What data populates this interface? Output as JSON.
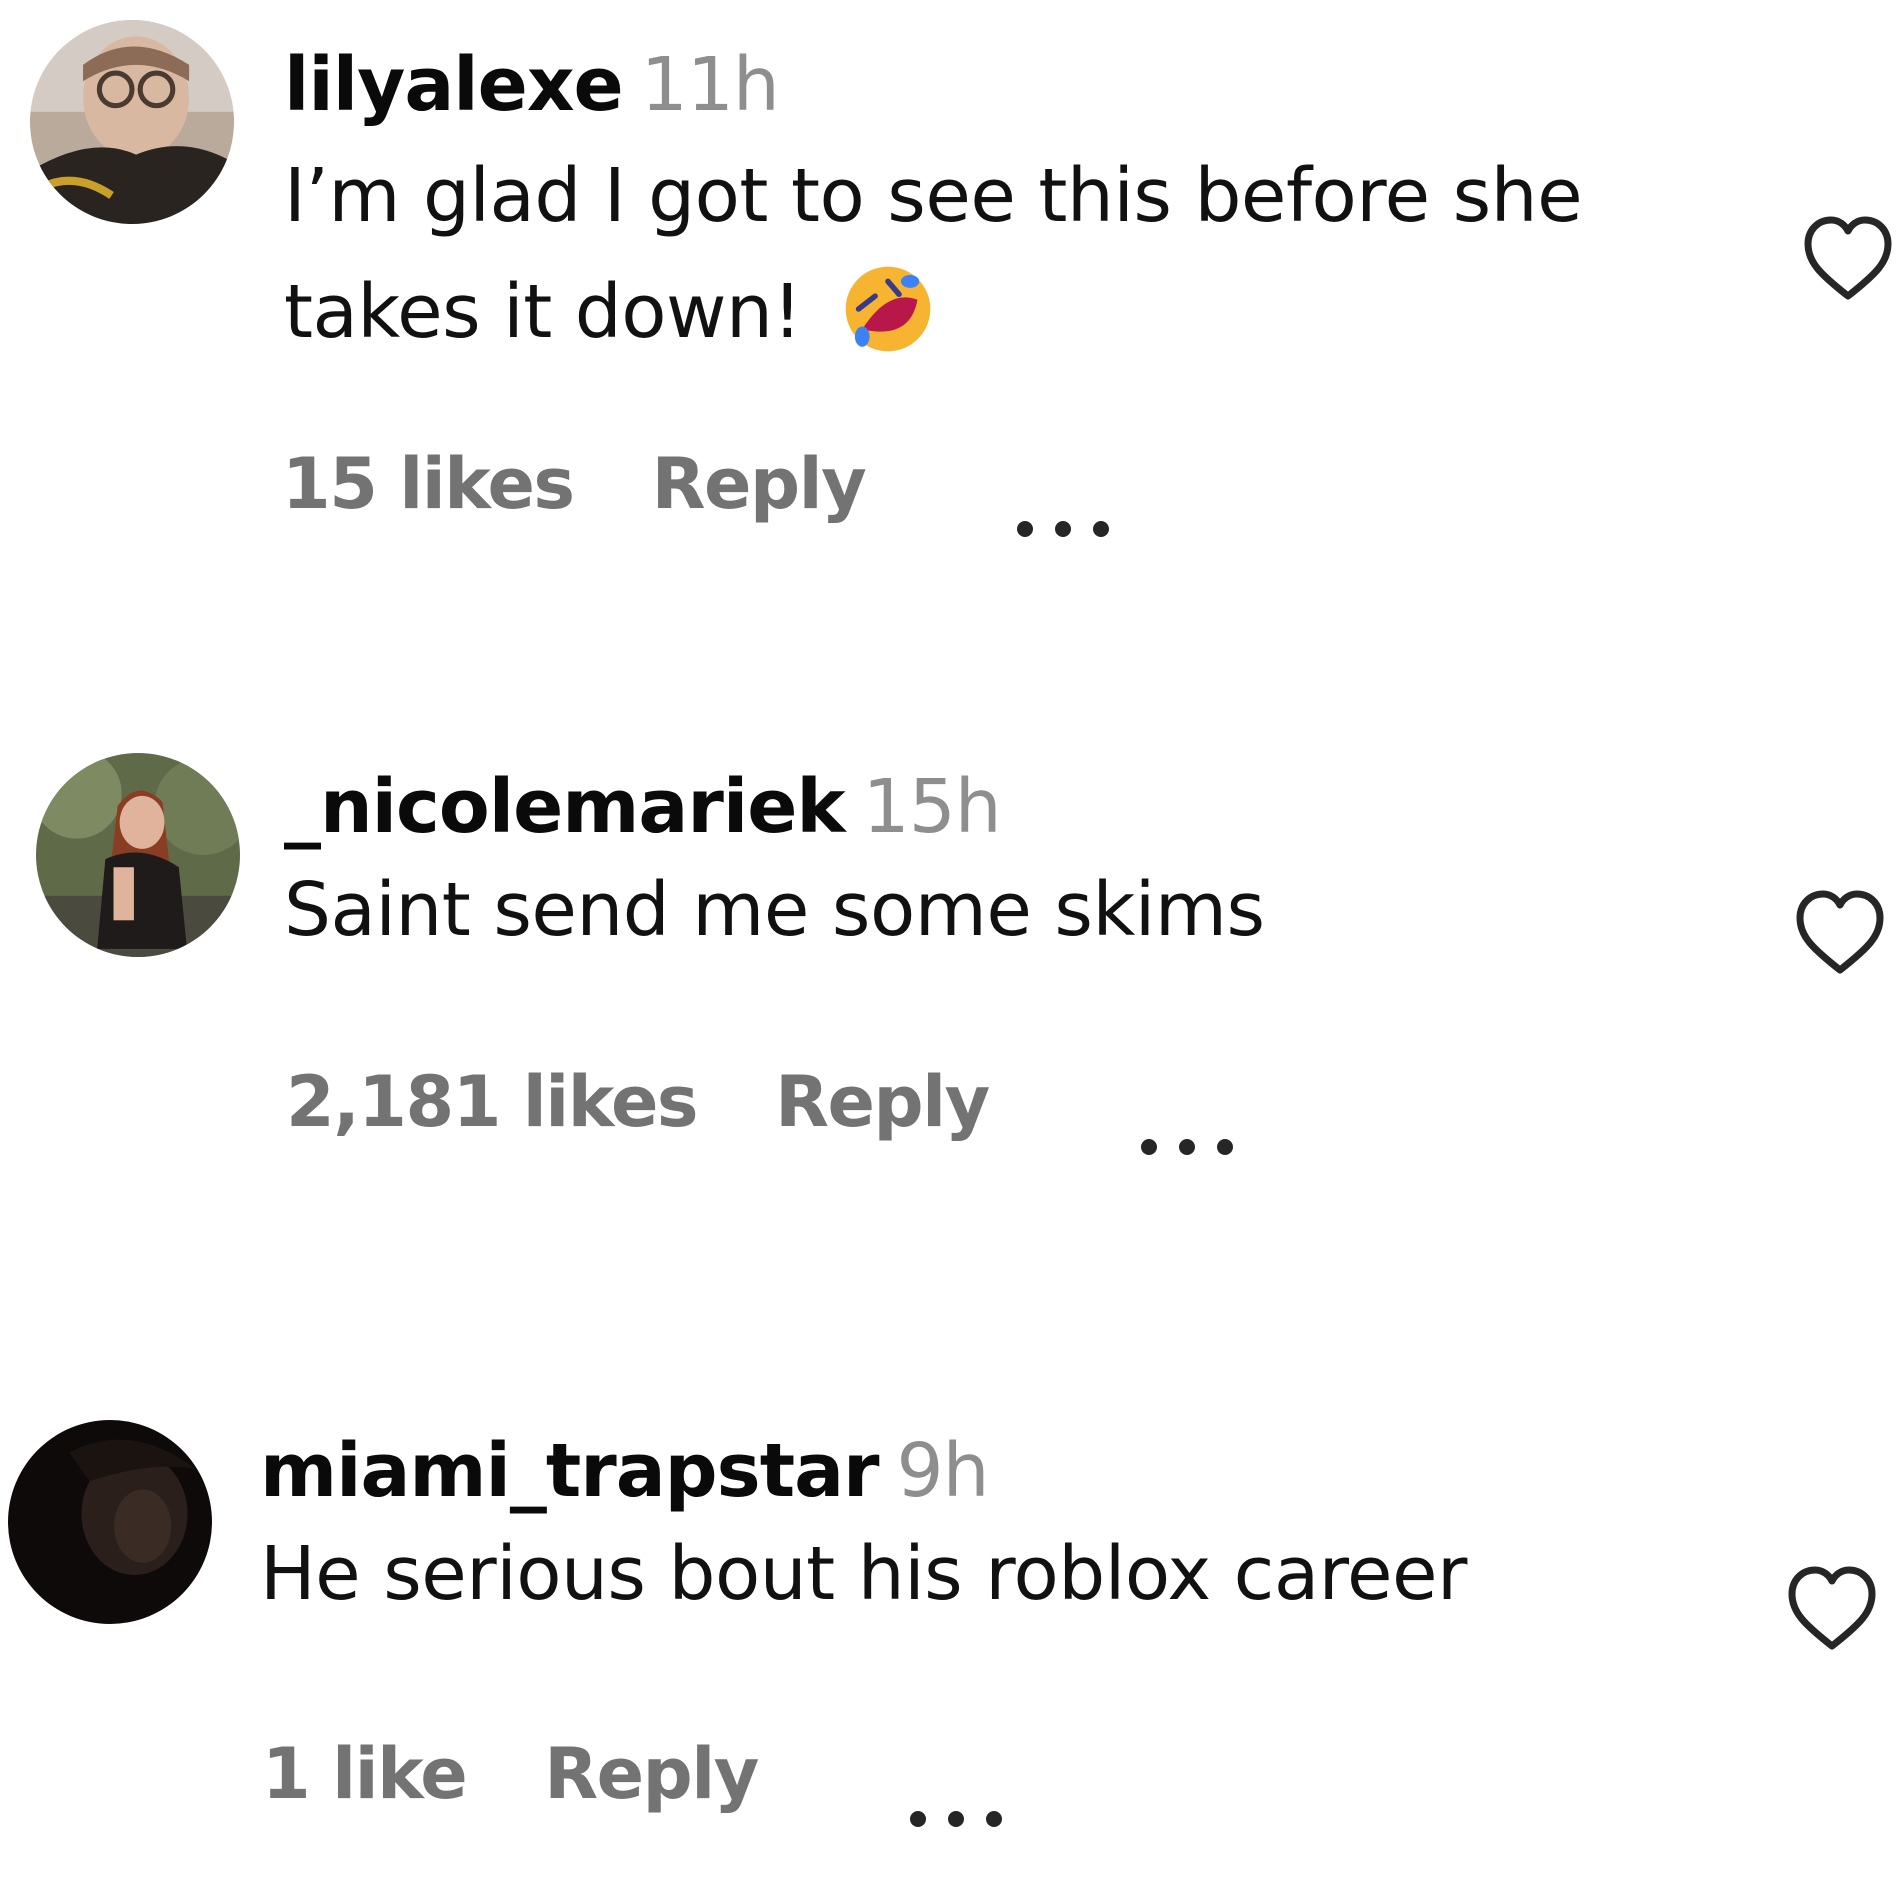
{
  "comments": [
    {
      "username": "lilyalexe",
      "time": "11h",
      "text_line1": "I’m glad I got to see this before she",
      "text_line2": "takes it down!",
      "emoji": "rolling-on-floor-laughing-emoji",
      "likes": "15 likes",
      "reply": "Reply"
    },
    {
      "username": "_nicolemariek",
      "time": "15h",
      "text_line1": "Saint send me some skims",
      "likes": "2,181 likes",
      "reply": "Reply"
    },
    {
      "username": "miami_trapstar",
      "time": "9h",
      "text_line1": "He serious bout his roblox career",
      "likes": "1 like",
      "reply": "Reply"
    }
  ],
  "colors": {
    "muted": "#737373",
    "timestamp": "#8e8e8e",
    "text": "#111111"
  }
}
